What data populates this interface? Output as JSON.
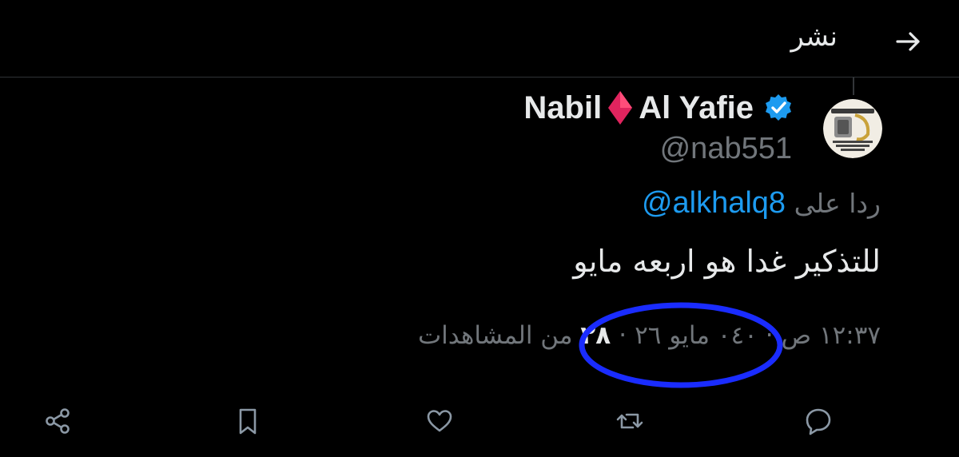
{
  "header": {
    "title": "نشر",
    "back_icon": "arrow-right-icon"
  },
  "tweet": {
    "author": {
      "name_first": "Nabil",
      "name_emoji": "diamond-icon",
      "name_last": "Al Yafie",
      "verified": true,
      "handle": "@nab551"
    },
    "reply_prefix": "ردا على",
    "reply_to": "@alkhalq8",
    "text": "للتذكير غدا هو اربعه مايو",
    "time": "١٢:٣٧ ص",
    "date": "٠٤٠ مايو ٢٦",
    "views_count": "٢٨",
    "views_label": "من المشاهدات"
  },
  "actions": [
    {
      "name": "reply",
      "icon": "reply-icon"
    },
    {
      "name": "retweet",
      "icon": "retweet-icon"
    },
    {
      "name": "like",
      "icon": "heart-icon"
    },
    {
      "name": "bookmark",
      "icon": "bookmark-icon"
    },
    {
      "name": "share",
      "icon": "share-icon"
    }
  ],
  "colors": {
    "background": "#000000",
    "text": "#e7e9ea",
    "secondary": "#71767b",
    "link": "#1d9bf0",
    "annotation": "#1a2cff"
  }
}
